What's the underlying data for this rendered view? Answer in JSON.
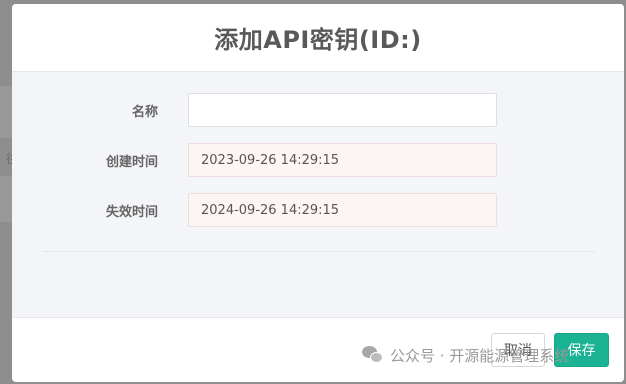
{
  "modal": {
    "title": "添加API密钥(ID:)"
  },
  "background": {
    "edge_char": "往"
  },
  "form": {
    "name": {
      "label": "名称",
      "value": "",
      "placeholder": ""
    },
    "created_time": {
      "label": "创建时间",
      "value": "2023-09-26 14:29:15"
    },
    "expire_time": {
      "label": "失效时间",
      "value": "2024-09-26 14:29:15"
    }
  },
  "footer": {
    "cancel_label": "取消",
    "save_label": "保存"
  },
  "watermark": {
    "text": "公众号 · 开源能源管理系统",
    "icon": "wechat-icon"
  },
  "colors": {
    "primary": "#1ab394",
    "readonly_bg": "#fdf5f4",
    "overlay": "#8e8e8e"
  }
}
